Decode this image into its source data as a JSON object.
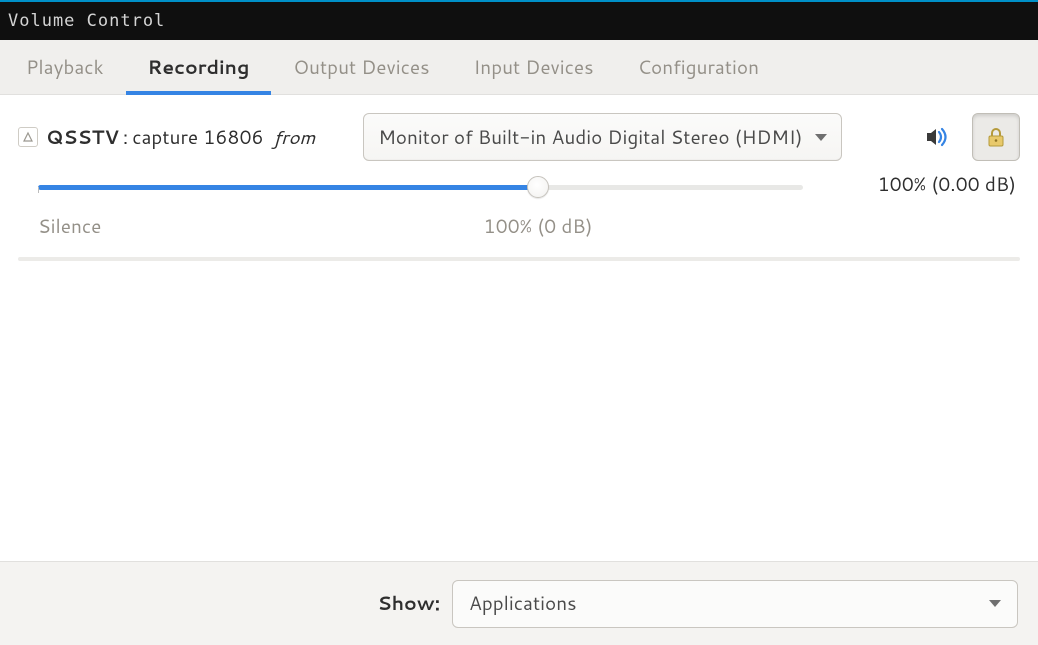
{
  "window_title": "Volume Control",
  "tabs": [
    {
      "label": "Playback",
      "active": false
    },
    {
      "label": "Recording",
      "active": true
    },
    {
      "label": "Output Devices",
      "active": false
    },
    {
      "label": "Input Devices",
      "active": false
    },
    {
      "label": "Configuration",
      "active": false
    }
  ],
  "stream": {
    "app_name": "QSSTV",
    "separator": " :",
    "description": "capture 16806",
    "from_label": "from",
    "source_selected": "Monitor of Built-in Audio Digital Stereo (HDMI)",
    "readout": "100% (0.00 dB)",
    "volume_percent": 100,
    "labels": {
      "silence": "Silence",
      "full": "100% (0 dB)"
    },
    "mute_pressed": false,
    "lock_pressed": true
  },
  "footer": {
    "show_label": "Show:",
    "selected": "Applications"
  }
}
